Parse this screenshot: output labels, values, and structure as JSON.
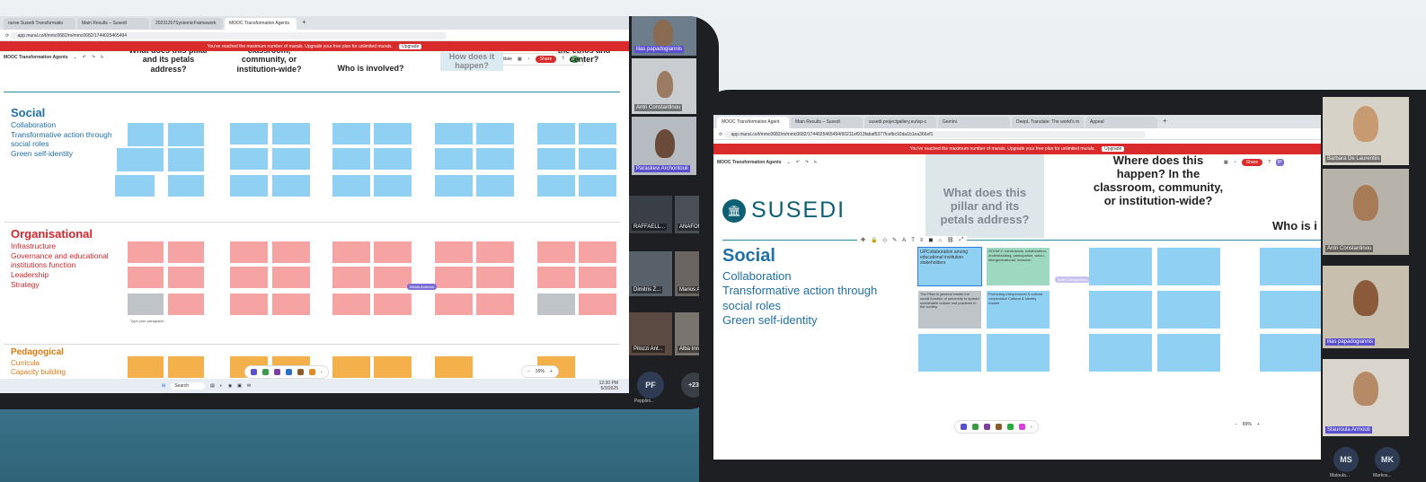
{
  "left_window": {
    "tabs": [
      {
        "label": "ourse Susedi Transformatio"
      },
      {
        "label": "Main Results – Susedi"
      },
      {
        "label": "20231207SystemicFramework"
      },
      {
        "label": "MOOC Transformation Agents"
      }
    ],
    "address": "app.mural.co/t/mmc0682/m/mmc0682/1744025465494",
    "banner": "You've reached the maximum number of murals. Upgrade your free plan for unlimited murals.",
    "upgrade": "Upgrade",
    "board_name": "MOOC Transformation Agents",
    "facilitate": "Facilitate",
    "share": "Share",
    "columns": [
      "What does this pillar and its petals address?",
      "classroom, community, or institution-wide?",
      "Who is involved?",
      "How does it happen?",
      "the ethos and center?"
    ],
    "pillars": [
      {
        "title": "Social",
        "subs": [
          "Collaboration",
          "Transformative action through",
          "social roles",
          "Green self-identity"
        ]
      },
      {
        "title": "Organisational",
        "subs": [
          "Infrastructure",
          "Governance and educational",
          "institutions function",
          "Leadership",
          "Strategy"
        ]
      },
      {
        "title": "Pedagogical",
        "subs": [
          "Curricula",
          "Capacity building"
        ]
      }
    ],
    "cursor_label": "Nicola Andreou",
    "type_hint": "Type your paragraph...",
    "zoom": "39%",
    "search": "Search",
    "clock": "12:30 PM",
    "date": "5/3/2025"
  },
  "left_participants": [
    {
      "name": "ilias papadogiannis"
    },
    {
      "name": "Antri Constantinou"
    },
    {
      "name": "Paraskevi Archontouli"
    },
    {
      "name": "RAFFAELL..."
    },
    {
      "name": "ANAFONI..."
    },
    {
      "name": "Dimitris Z..."
    },
    {
      "name": "Marios An..."
    },
    {
      "name": "Pilozzi Ant..."
    },
    {
      "name": "Alba Inno..."
    }
  ],
  "left_bottom": {
    "initials": "PF",
    "name": "Pepplini...",
    "more": "+23"
  },
  "right_window": {
    "tabs": [
      {
        "label": "MOOC Transformation Agent"
      },
      {
        "label": "Main Results – Susedi"
      },
      {
        "label": "susedi.projectgallery.eu/wp-c"
      },
      {
        "label": "Gemini"
      },
      {
        "label": "DeepL Translate: The world's m"
      },
      {
        "label": "Appeal"
      }
    ],
    "address": "app.mural.co/t/mmc0682/m/mmc0682/1744025465494/60211ef913fabaf5377fcefbc92da1b1ea366ef1",
    "banner": "You've reached the maximum number of murals. Upgrade your free plan for unlimited murals.",
    "upgrade": "Upgrade",
    "board_name": "MOOC Transformation Agents",
    "share": "Share",
    "logo": "SUSEDI",
    "columns": [
      "What does this pillar and its petals address?",
      "Where does this happen? In the classroom, community, or institution-wide?",
      "Who is i"
    ],
    "pillar": {
      "title": "Social",
      "subs": [
        "Collaboration",
        "Transformative action through",
        "social roles",
        "Green self-identity"
      ]
    },
    "notes": [
      "UPCollaboration among educational institution stakeholders",
      "ROOM 2: conclusions, collaboration, understanding, participation, vision, intergenerational, inclusion",
      "The Pillar in general entails the social function of university to spread sustainable culture and practices in the society.",
      "Promoting interpersonal & cultural cooperation Cultural & identity transfo"
    ],
    "cursor_label": "Antri Constantinou",
    "zoom": "89%"
  },
  "right_participants": [
    {
      "name": "Barbara De Laurentiis"
    },
    {
      "name": "Antri Constantinou"
    },
    {
      "name": "ilias papadogiannis"
    },
    {
      "name": "Stauroula Armouti"
    }
  ],
  "right_bottom": [
    {
      "initials": "MS",
      "name": "Matoula..."
    },
    {
      "initials": "MK",
      "name": "Markos..."
    }
  ],
  "colors": {
    "banner": "#d92b2b",
    "accent": "#1f6fa8",
    "social": "#1f6fa8",
    "organisational": "#d3262b",
    "pedagogical": "#d97a14",
    "blue_note": "#8fd0f3",
    "red_note": "#f5a3a3",
    "orange_note": "#f4b04a"
  }
}
